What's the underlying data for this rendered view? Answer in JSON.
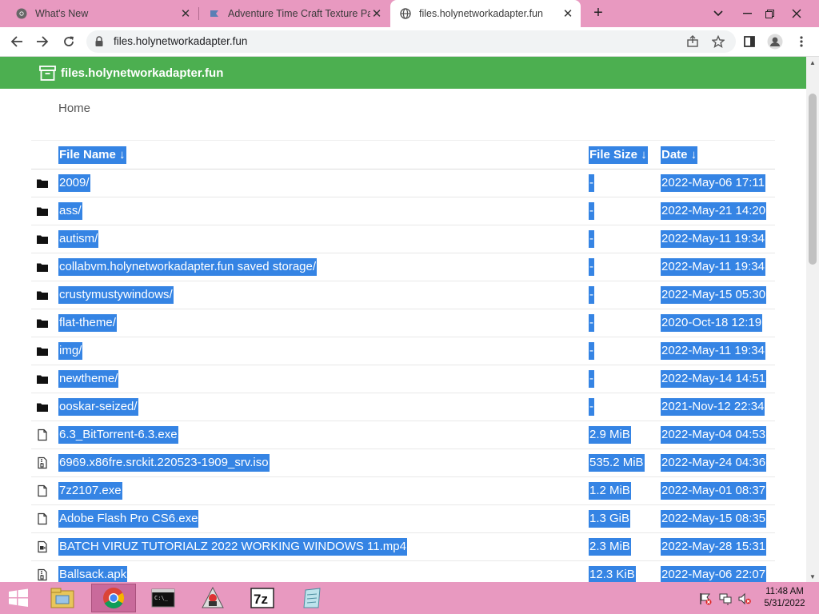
{
  "browser": {
    "tabs": [
      {
        "title": "What's New",
        "active": false,
        "favicon": "chrome-icon"
      },
      {
        "title": "Adventure Time Craft Texture Pa",
        "active": false,
        "favicon": "craft-icon"
      },
      {
        "title": "files.holynetworkadapter.fun",
        "active": true,
        "favicon": "globe-icon"
      }
    ],
    "url": "files.holynetworkadapter.fun"
  },
  "site": {
    "name": "files.holynetworkadapter.fun",
    "breadcrumb": "Home",
    "columns": {
      "name": "File Name  ↓",
      "size": "File Size  ↓",
      "date": "Date  ↓"
    },
    "files": [
      {
        "name": "2009/",
        "size": "-",
        "date": "2022-May-06 17:11",
        "type": "folder"
      },
      {
        "name": "ass/",
        "size": "-",
        "date": "2022-May-21 14:20",
        "type": "folder"
      },
      {
        "name": "autism/",
        "size": "-",
        "date": "2022-May-11 19:34",
        "type": "folder"
      },
      {
        "name": "collabvm.holynetworkadapter.fun saved storage/",
        "size": "-",
        "date": "2022-May-11 19:34",
        "type": "folder"
      },
      {
        "name": "crustymustywindows/",
        "size": "-",
        "date": "2022-May-15 05:30",
        "type": "folder"
      },
      {
        "name": "flat-theme/",
        "size": "-",
        "date": "2020-Oct-18 12:19",
        "type": "folder"
      },
      {
        "name": "img/",
        "size": "-",
        "date": "2022-May-11 19:34",
        "type": "folder"
      },
      {
        "name": "newtheme/",
        "size": "-",
        "date": "2022-May-14 14:51",
        "type": "folder"
      },
      {
        "name": "ooskar-seized/",
        "size": "-",
        "date": "2021-Nov-12 22:34",
        "type": "folder"
      },
      {
        "name": "6.3_BitTorrent-6.3.exe",
        "size": "2.9 MiB",
        "date": "2022-May-04 04:53",
        "type": "file"
      },
      {
        "name": "6969.x86fre.srckit.220523-1909_srv.iso",
        "size": "535.2 MiB",
        "date": "2022-May-24 04:36",
        "type": "archive"
      },
      {
        "name": "7z2107.exe",
        "size": "1.2 MiB",
        "date": "2022-May-01 08:37",
        "type": "file"
      },
      {
        "name": "Adobe Flash Pro CS6.exe",
        "size": "1.3 GiB",
        "date": "2022-May-15 08:35",
        "type": "file"
      },
      {
        "name": "BATCH VIRUZ TUTORIALZ 2022 WORKING WINDOWS 11.mp4",
        "size": "2.3 MiB",
        "date": "2022-May-28 15:31",
        "type": "video"
      },
      {
        "name": "Ballsack.apk",
        "size": "12.3 KiB",
        "date": "2022-May-06 22:07",
        "type": "archive"
      }
    ]
  },
  "taskbar": {
    "apps": [
      "explorer-icon",
      "chrome-icon",
      "cmd-icon",
      "java-icon",
      "7zip-icon",
      "notepad-icon"
    ],
    "time": "11:48 AM",
    "date": "5/31/2022"
  },
  "colors": {
    "header": "#4caf50",
    "selection": "#3584e4",
    "chrome_frame": "#e899c0"
  }
}
